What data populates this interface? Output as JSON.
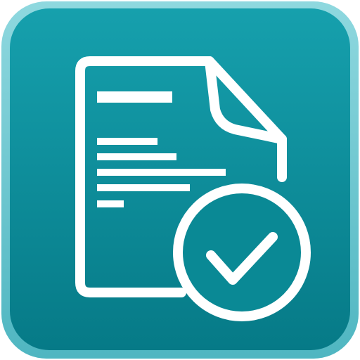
{
  "app_icon": {
    "icon_name": "document-check-icon",
    "colors": {
      "tile_outer": "#7fd0d8",
      "tile_inner_top": "#1aa0ad",
      "tile_inner_bottom": "#077d8a",
      "glyph": "#ffffff"
    },
    "document": {
      "icon_name": "document-icon",
      "text_lines": [
        {
          "role": "heading-line"
        },
        {
          "role": "body-line"
        },
        {
          "role": "body-line"
        },
        {
          "role": "body-line"
        },
        {
          "role": "body-line"
        },
        {
          "role": "body-line"
        }
      ]
    },
    "badge": {
      "icon_name": "checkmark-circle-icon"
    }
  }
}
